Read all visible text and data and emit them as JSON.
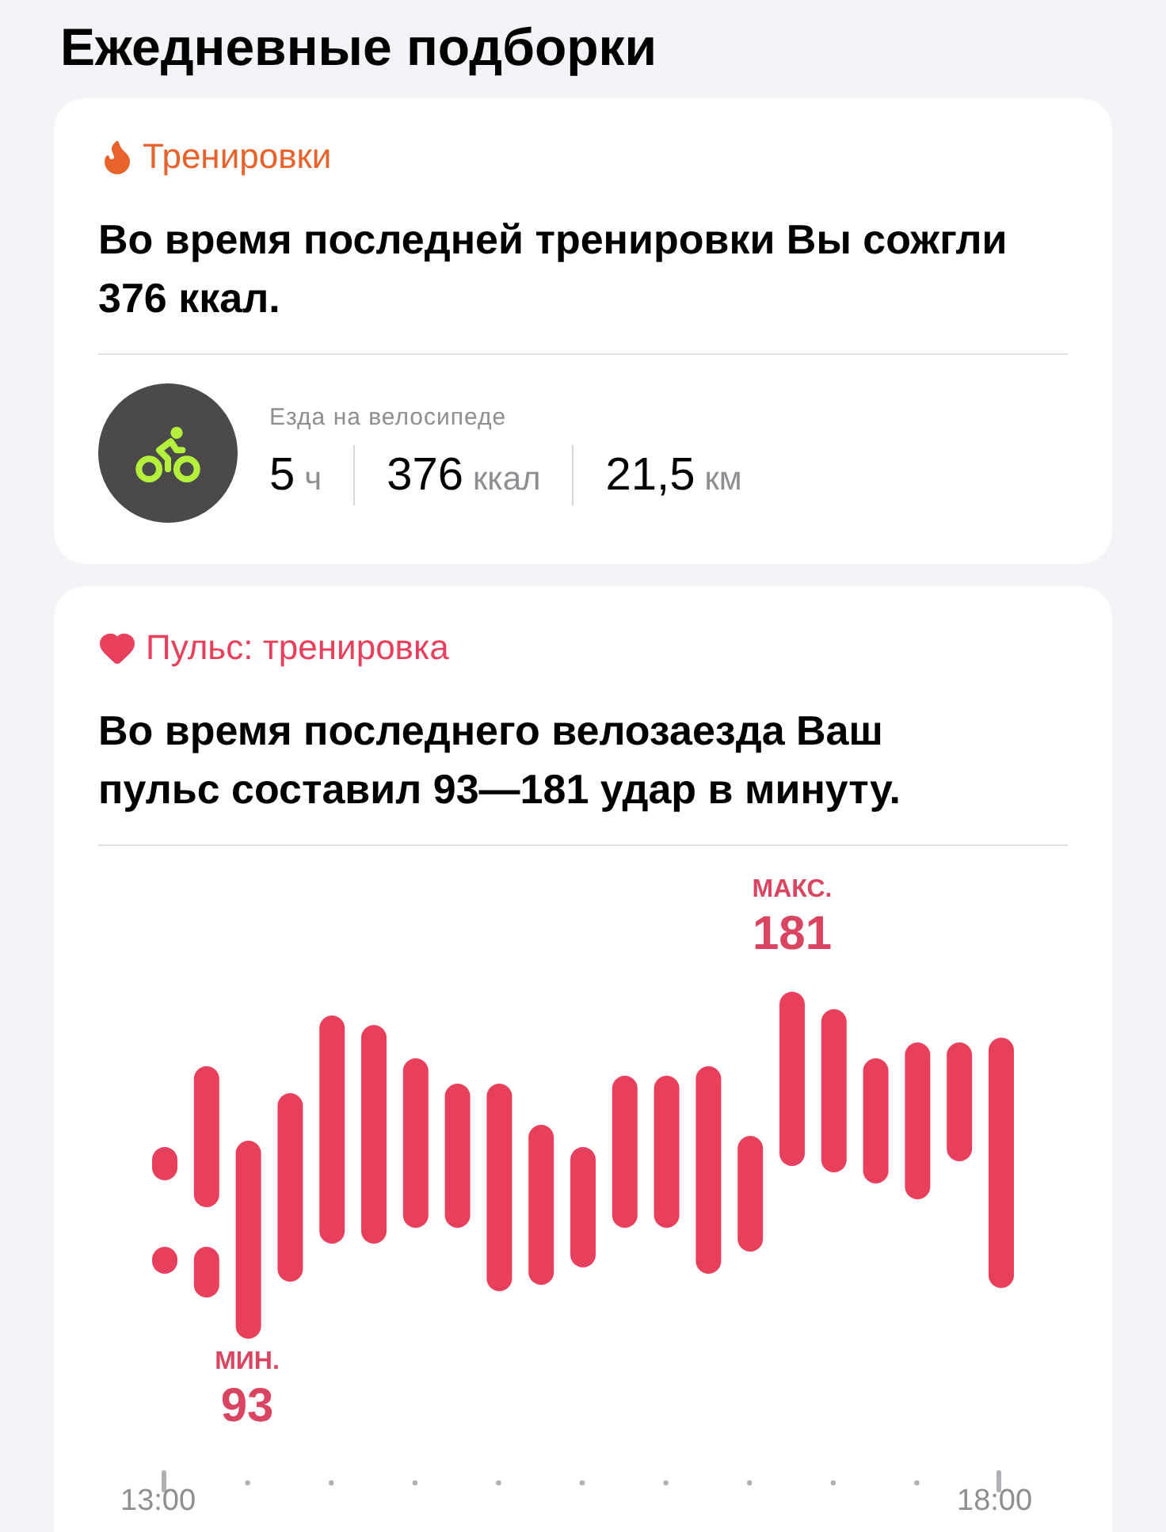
{
  "heading": "Ежедневные подборки",
  "workouts": {
    "title": "Тренировки",
    "summary": "Во время последней тренировки Вы сожгли 376 ккал.",
    "activity": {
      "name": "Езда на велосипеде",
      "stats": [
        {
          "value": "5",
          "unit": "ч"
        },
        {
          "value": "376",
          "unit": "ккал"
        },
        {
          "value": "21,5",
          "unit": "км"
        }
      ]
    }
  },
  "heart": {
    "title": "Пульс: тренировка",
    "summary": "Во время последнего велозаезда Ваш пульс составил 93—181 удар в минуту.",
    "min": {
      "label": "МИН.",
      "value": "93"
    },
    "max": {
      "label": "МАКС.",
      "value": "181"
    },
    "axis_labels": [
      "13:00",
      "18:00"
    ]
  }
}
